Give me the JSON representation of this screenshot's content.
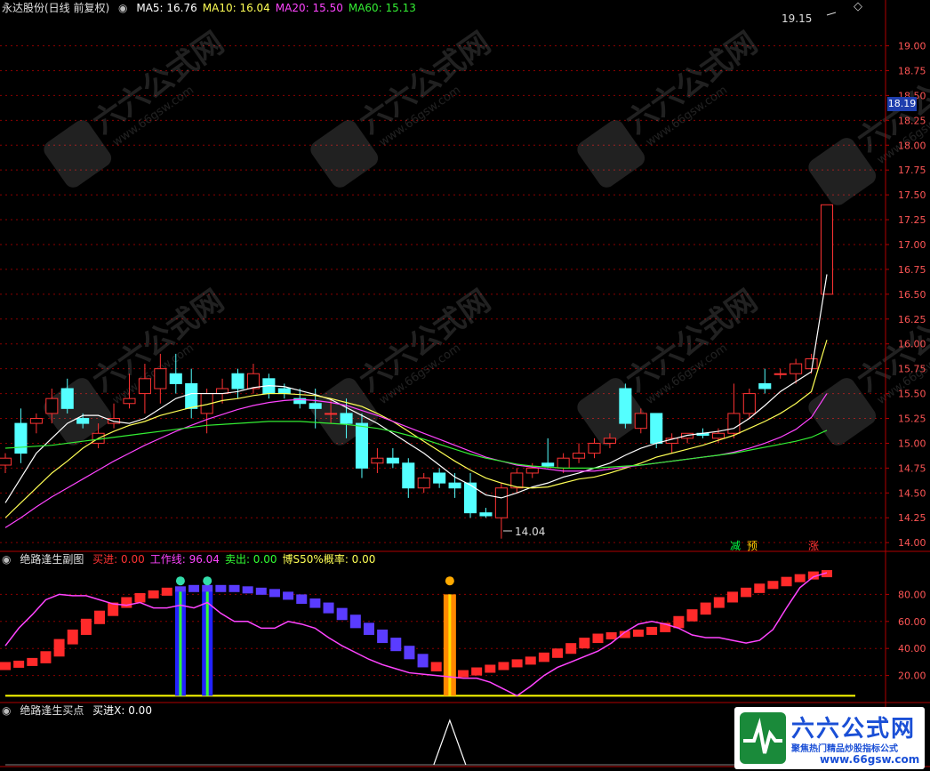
{
  "header": {
    "title": "永达股份(日线 前复权)",
    "ma_items": [
      {
        "label": "MA5: 16.76",
        "color": "#ffffff"
      },
      {
        "label": "MA10: 16.04",
        "color": "#ffff55"
      },
      {
        "label": "MA20: 15.50",
        "color": "#ff44ff"
      },
      {
        "label": "MA60: 15.13",
        "color": "#33ee33"
      }
    ]
  },
  "panel2_header": {
    "title": "绝路逢生副图",
    "items": [
      {
        "label": "买进: 0.00",
        "color": "#ff3333"
      },
      {
        "label": "工作线: 96.04",
        "color": "#ff44ff"
      },
      {
        "label": "卖出: 0.00",
        "color": "#33ff33"
      },
      {
        "label": "博S50%概率: 0.00",
        "color": "#ffff55"
      }
    ]
  },
  "panel3_header": {
    "title": "绝路逢生买点",
    "items": [
      {
        "label": "买进X: 0.00",
        "color": "#ffffff"
      }
    ]
  },
  "annotations": {
    "high_label": "19.15",
    "low_label": "14.04",
    "current_price": "18.19",
    "signals": [
      {
        "text": "减",
        "color": "#00cc33",
        "bg": "#00cc33"
      },
      {
        "text": "预",
        "color": "#ffcc00",
        "bg": "#ffcc00"
      },
      {
        "text": "涨",
        "color": "#ff3333",
        "bg": "#ff3333"
      }
    ]
  },
  "watermark": {
    "big": "六六公式网",
    "sub": "聚焦热门精品炒股指标公式",
    "url": "www.66gsw.com"
  },
  "colors": {
    "up": "#ff3333",
    "down": "#54ffff",
    "grid": "#8b0000",
    "axis": "#b00000"
  },
  "chart_data": [
    {
      "type": "candlestick",
      "title": "永达股份(日线 前复权)",
      "y_ticks": [
        14.0,
        14.25,
        14.5,
        14.75,
        15.0,
        15.25,
        15.5,
        15.75,
        16.0,
        16.25,
        16.5,
        16.75,
        17.0,
        17.25,
        17.5,
        17.75,
        18.0,
        18.25,
        18.5,
        18.75,
        19.0
      ],
      "ylim": [
        13.93,
        19.3
      ],
      "candles": [
        [
          14.78,
          14.9,
          14.7,
          14.85
        ],
        [
          15.2,
          15.35,
          14.8,
          14.9
        ],
        [
          15.2,
          15.3,
          15.1,
          15.25
        ],
        [
          15.3,
          15.55,
          15.2,
          15.45
        ],
        [
          15.55,
          15.65,
          15.3,
          15.35
        ],
        [
          15.25,
          15.3,
          15.15,
          15.2
        ],
        [
          15.0,
          15.2,
          14.95,
          15.1
        ],
        [
          15.2,
          15.4,
          15.15,
          15.25
        ],
        [
          15.4,
          15.7,
          15.35,
          15.45
        ],
        [
          15.5,
          15.8,
          15.3,
          15.65
        ],
        [
          15.55,
          15.9,
          15.4,
          15.75
        ],
        [
          15.7,
          15.9,
          15.5,
          15.6
        ],
        [
          15.6,
          15.75,
          15.25,
          15.35
        ],
        [
          15.3,
          15.55,
          15.1,
          15.5
        ],
        [
          15.5,
          15.65,
          15.4,
          15.55
        ],
        [
          15.7,
          15.75,
          15.45,
          15.55
        ],
        [
          15.55,
          15.8,
          15.5,
          15.7
        ],
        [
          15.65,
          15.7,
          15.45,
          15.5
        ],
        [
          15.55,
          15.6,
          15.45,
          15.5
        ],
        [
          15.45,
          15.55,
          15.35,
          15.4
        ],
        [
          15.4,
          15.55,
          15.15,
          15.35
        ],
        [
          15.3,
          15.45,
          15.2,
          15.3
        ],
        [
          15.3,
          15.45,
          15.05,
          15.2
        ],
        [
          15.2,
          15.3,
          14.65,
          14.75
        ],
        [
          14.8,
          14.95,
          14.7,
          14.85
        ],
        [
          14.85,
          14.95,
          14.75,
          14.8
        ],
        [
          14.8,
          14.85,
          14.45,
          14.55
        ],
        [
          14.55,
          14.7,
          14.5,
          14.65
        ],
        [
          14.7,
          14.75,
          14.55,
          14.6
        ],
        [
          14.6,
          14.7,
          14.45,
          14.55
        ],
        [
          14.6,
          14.7,
          14.25,
          14.3
        ],
        [
          14.3,
          14.35,
          14.25,
          14.27
        ],
        [
          14.25,
          14.6,
          14.04,
          14.55
        ],
        [
          14.55,
          14.75,
          14.5,
          14.7
        ],
        [
          14.7,
          14.8,
          14.65,
          14.75
        ],
        [
          14.8,
          15.05,
          14.75,
          14.77
        ],
        [
          14.75,
          14.9,
          14.7,
          14.85
        ],
        [
          14.85,
          15.0,
          14.8,
          14.9
        ],
        [
          14.9,
          15.05,
          14.85,
          15.0
        ],
        [
          15.0,
          15.1,
          14.95,
          15.05
        ],
        [
          15.55,
          15.6,
          15.15,
          15.2
        ],
        [
          15.15,
          15.35,
          15.1,
          15.3
        ],
        [
          15.3,
          15.3,
          14.95,
          15.0
        ],
        [
          15.0,
          15.1,
          14.9,
          15.05
        ],
        [
          15.05,
          15.1,
          15.0,
          15.1
        ],
        [
          15.1,
          15.15,
          15.05,
          15.08
        ],
        [
          15.05,
          15.15,
          15.0,
          15.1
        ],
        [
          15.1,
          15.6,
          15.05,
          15.3
        ],
        [
          15.3,
          15.55,
          15.25,
          15.5
        ],
        [
          15.6,
          15.75,
          15.5,
          15.55
        ],
        [
          15.7,
          15.75,
          15.65,
          15.7
        ],
        [
          15.7,
          15.85,
          15.6,
          15.8
        ],
        [
          15.75,
          15.9,
          15.7,
          15.85
        ],
        [
          16.5,
          17.4,
          16.5,
          17.4
        ]
      ],
      "series": [
        {
          "name": "MA5",
          "color": "#ffffff",
          "values": [
            14.4,
            14.65,
            14.9,
            15.05,
            15.2,
            15.28,
            15.28,
            15.22,
            15.2,
            15.25,
            15.35,
            15.45,
            15.5,
            15.5,
            15.5,
            15.52,
            15.56,
            15.58,
            15.57,
            15.53,
            15.49,
            15.44,
            15.36,
            15.28,
            15.2,
            15.1,
            15.0,
            14.9,
            14.78,
            14.66,
            14.58,
            14.48,
            14.45,
            14.5,
            14.56,
            14.6,
            14.66,
            14.7,
            14.75,
            14.8,
            14.88,
            14.95,
            15.0,
            15.04,
            15.08,
            15.1,
            15.12,
            15.15,
            15.25,
            15.38,
            15.52,
            15.62,
            15.72,
            16.7
          ]
        },
        {
          "name": "MA10",
          "color": "#ffff55",
          "values": [
            14.25,
            14.4,
            14.55,
            14.7,
            14.82,
            14.95,
            15.05,
            15.12,
            15.18,
            15.22,
            15.28,
            15.32,
            15.36,
            15.39,
            15.43,
            15.45,
            15.48,
            15.5,
            15.5,
            15.49,
            15.48,
            15.45,
            15.41,
            15.37,
            15.3,
            15.22,
            15.12,
            15.02,
            14.92,
            14.82,
            14.73,
            14.65,
            14.6,
            14.56,
            14.55,
            14.56,
            14.6,
            14.64,
            14.66,
            14.7,
            14.75,
            14.8,
            14.86,
            14.9,
            14.94,
            14.98,
            15.03,
            15.08,
            15.15,
            15.22,
            15.3,
            15.4,
            15.52,
            16.04
          ]
        },
        {
          "name": "MA20",
          "color": "#ff44ff",
          "values": [
            14.15,
            14.25,
            14.36,
            14.46,
            14.55,
            14.64,
            14.73,
            14.82,
            14.9,
            14.98,
            15.05,
            15.12,
            15.18,
            15.24,
            15.29,
            15.34,
            15.38,
            15.41,
            15.43,
            15.44,
            15.43,
            15.41,
            15.38,
            15.33,
            15.28,
            15.22,
            15.16,
            15.1,
            15.04,
            14.98,
            14.92,
            14.86,
            14.82,
            14.78,
            14.76,
            14.74,
            14.72,
            14.72,
            14.72,
            14.74,
            14.76,
            14.78,
            14.8,
            14.82,
            14.84,
            14.86,
            14.88,
            14.91,
            14.95,
            15.0,
            15.06,
            15.14,
            15.26,
            15.5
          ]
        },
        {
          "name": "MA60",
          "color": "#33ee33",
          "values": [
            14.95,
            14.96,
            14.97,
            14.98,
            15.0,
            15.02,
            15.04,
            15.06,
            15.08,
            15.1,
            15.12,
            15.14,
            15.16,
            15.18,
            15.19,
            15.2,
            15.21,
            15.22,
            15.22,
            15.22,
            15.21,
            15.2,
            15.19,
            15.17,
            15.15,
            15.12,
            15.08,
            15.04,
            14.99,
            14.94,
            14.89,
            14.85,
            14.82,
            14.79,
            14.77,
            14.76,
            14.75,
            14.75,
            14.75,
            14.76,
            14.77,
            14.78,
            14.8,
            14.82,
            14.84,
            14.86,
            14.88,
            14.9,
            14.93,
            14.96,
            14.99,
            15.02,
            15.06,
            15.13
          ]
        }
      ]
    },
    {
      "type": "bar",
      "title": "绝路逢生副图",
      "y_ticks": [
        20.0,
        40.0,
        60.0,
        80.0
      ],
      "ylim": [
        0,
        100
      ],
      "bar_values": [
        28,
        29,
        31,
        36,
        45,
        52,
        60,
        66,
        72,
        76,
        79,
        81,
        83,
        84,
        85,
        85,
        85,
        84,
        83,
        82,
        80,
        78,
        75,
        72,
        68,
        63,
        57,
        52,
        46,
        40,
        34,
        28,
        25,
        22,
        22,
        24,
        26,
        28,
        30,
        32,
        35,
        38,
        42,
        46,
        49,
        50,
        51,
        52,
        54,
        57,
        62,
        67,
        72,
        76,
        80,
        83,
        86,
        88,
        91,
        93,
        95,
        96
      ],
      "work_line": [
        42,
        55,
        65,
        76,
        80,
        79,
        79,
        76,
        73,
        72,
        74,
        70,
        70,
        72,
        70,
        74,
        66,
        60,
        60,
        55,
        55,
        60,
        58,
        55,
        48,
        42,
        37,
        32,
        28,
        25,
        22,
        21,
        20,
        19,
        18,
        18,
        15,
        10,
        5,
        12,
        20,
        26,
        30,
        34,
        38,
        44,
        52,
        58,
        60,
        58,
        55,
        50,
        48,
        48,
        46,
        44,
        46,
        54,
        70,
        85,
        93,
        96
      ],
      "bar_colors": [
        "#ff2a2a",
        "#ff2a2a",
        "#ff2a2a",
        "#ff2a2a",
        "#ff2a2a",
        "#ff2a2a",
        "#ff2a2a",
        "#ff2a2a",
        "#ff2a2a",
        "#ff2a2a",
        "#ff2a2a",
        "#ff2a2a",
        "#ff2a2a",
        "#5a3cff",
        "#5a3cff",
        "#5a3cff",
        "#5a3cff",
        "#5a3cff",
        "#5a3cff",
        "#5a3cff",
        "#5a3cff",
        "#5a3cff",
        "#5a3cff",
        "#5a3cff",
        "#5a3cff",
        "#5a3cff",
        "#5a3cff",
        "#5a3cff",
        "#5a3cff",
        "#5a3cff",
        "#5a3cff",
        "#5a3cff",
        "#ff2a2a",
        "#ff2a2a",
        "#ff2a2a",
        "#ff2a2a",
        "#ff2a2a",
        "#ff2a2a",
        "#ff2a2a",
        "#ff2a2a",
        "#ff2a2a",
        "#ff2a2a",
        "#ff2a2a",
        "#ff2a2a",
        "#ff2a2a",
        "#ff2a2a",
        "#ff2a2a",
        "#ff2a2a",
        "#ff2a2a",
        "#ff2a2a",
        "#ff2a2a",
        "#ff2a2a",
        "#ff2a2a",
        "#ff2a2a",
        "#ff2a2a",
        "#ff2a2a",
        "#ff2a2a",
        "#ff2a2a",
        "#ff2a2a",
        "#ff2a2a",
        "#ff2a2a",
        "#ff2a2a"
      ],
      "sell_signals": [
        13,
        15
      ],
      "buy_signal": 33,
      "baseline": 5
    },
    {
      "type": "line",
      "title": "绝路逢生买点",
      "spike_index": 33,
      "values_note": ""
    }
  ]
}
